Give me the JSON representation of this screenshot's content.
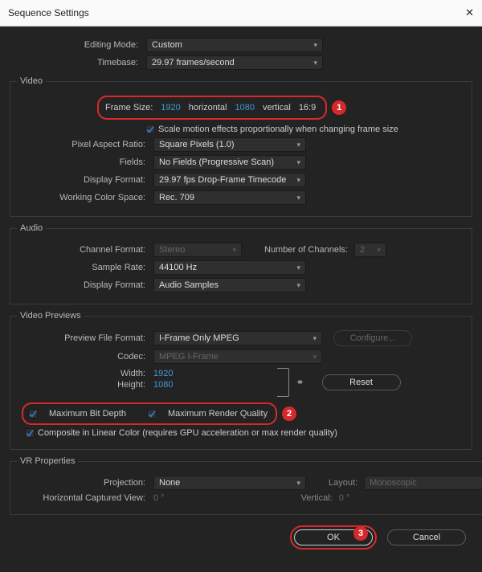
{
  "window": {
    "title": "Sequence Settings"
  },
  "top": {
    "editing_mode_label": "Editing Mode:",
    "editing_mode_value": "Custom",
    "timebase_label": "Timebase:",
    "timebase_value": "29.97  frames/second"
  },
  "video": {
    "legend": "Video",
    "frame_size_label": "Frame Size:",
    "width": "1920",
    "horizontal_label": "horizontal",
    "height": "1080",
    "vertical_label": "vertical",
    "aspect": "16:9",
    "scale_motion_label": "Scale motion effects proportionally when changing frame size",
    "par_label": "Pixel Aspect Ratio:",
    "par_value": "Square Pixels (1.0)",
    "fields_label": "Fields:",
    "fields_value": "No Fields (Progressive Scan)",
    "display_format_label": "Display Format:",
    "display_format_value": "29.97 fps Drop-Frame Timecode",
    "working_cs_label": "Working Color Space:",
    "working_cs_value": "Rec. 709"
  },
  "audio": {
    "legend": "Audio",
    "channel_format_label": "Channel Format:",
    "channel_format_value": "Stereo",
    "num_channels_label": "Number of Channels:",
    "num_channels_value": "2",
    "sample_rate_label": "Sample Rate:",
    "sample_rate_value": "44100 Hz",
    "display_format_label": "Display Format:",
    "display_format_value": "Audio Samples"
  },
  "previews": {
    "legend": "Video Previews",
    "preview_ff_label": "Preview File Format:",
    "preview_ff_value": "I-Frame Only MPEG",
    "configure_label": "Configure...",
    "codec_label": "Codec:",
    "codec_value": "MPEG I-Frame",
    "width_label": "Width:",
    "width_value": "1920",
    "height_label": "Height:",
    "height_value": "1080",
    "reset_label": "Reset",
    "max_bit_depth_label": "Maximum Bit Depth",
    "max_render_q_label": "Maximum Render Quality",
    "composite_label": "Composite in Linear Color (requires GPU acceleration or max render quality)"
  },
  "vr": {
    "legend": "VR Properties",
    "projection_label": "Projection:",
    "projection_value": "None",
    "layout_label": "Layout:",
    "layout_value": "Monoscopic",
    "hcv_label": "Horizontal Captured View:",
    "hcv_value": "0 °",
    "vertical_label": "Vertical:",
    "vertical_value": "0 °"
  },
  "buttons": {
    "ok": "OK",
    "cancel": "Cancel"
  },
  "annotations": {
    "a1": "1",
    "a2": "2",
    "a3": "3"
  }
}
